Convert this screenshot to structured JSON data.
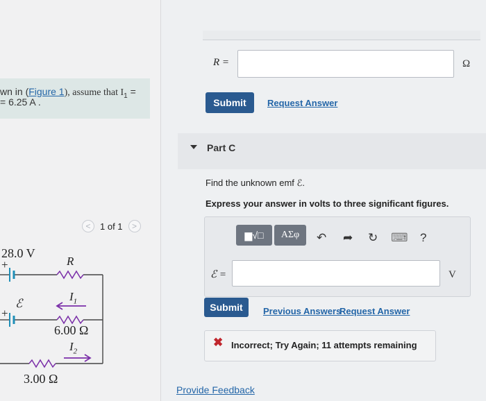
{
  "intro": {
    "text_prefix": "wn in (",
    "figure_link": "Figure 1",
    "text_suffix": "), assume that I",
    "subscript": "1",
    "equals": " =",
    "line2": "= 6.25 A ."
  },
  "pager": {
    "prev": "<",
    "label": "1 of 1",
    "next": ">"
  },
  "figure": {
    "voltage": "28.0 V",
    "plus_top": "+",
    "plus_bottom": "+",
    "resistor_R": "R",
    "emf": "ℰ",
    "current1": "I",
    "current1_sub": "1",
    "resistor_6": "6.00 Ω",
    "current2": "I",
    "current2_sub": "2",
    "resistor_3": "3.00 Ω"
  },
  "part_b": {
    "label": "R =",
    "value": "",
    "unit": "Ω",
    "submit": "Submit",
    "request": "Request Answer"
  },
  "part_c": {
    "title": "Part C",
    "prompt": "Find the unknown emf ℰ.",
    "instruction": "Express your answer in volts to three significant figures.",
    "toolbar": {
      "templates": "▆√□",
      "symbols": "ΑΣφ",
      "undo": "↶",
      "redo": "➦",
      "reset": "↻",
      "keyboard": "⌨",
      "help": "?"
    },
    "label": "ℰ =",
    "value": "",
    "unit": "V",
    "submit": "Submit",
    "previous": "Previous Answers",
    "request": "Request Answer",
    "feedback_icon": "✖",
    "feedback": "Incorrect; Try Again; 11 attempts remaining"
  },
  "footer": {
    "provide_feedback": "Provide Feedback"
  },
  "colors": {
    "accent": "#2a5a90",
    "link": "#2466a8",
    "error": "#c0262d",
    "circuit": "#1f8fb8",
    "resistor": "#7a2ea8"
  }
}
